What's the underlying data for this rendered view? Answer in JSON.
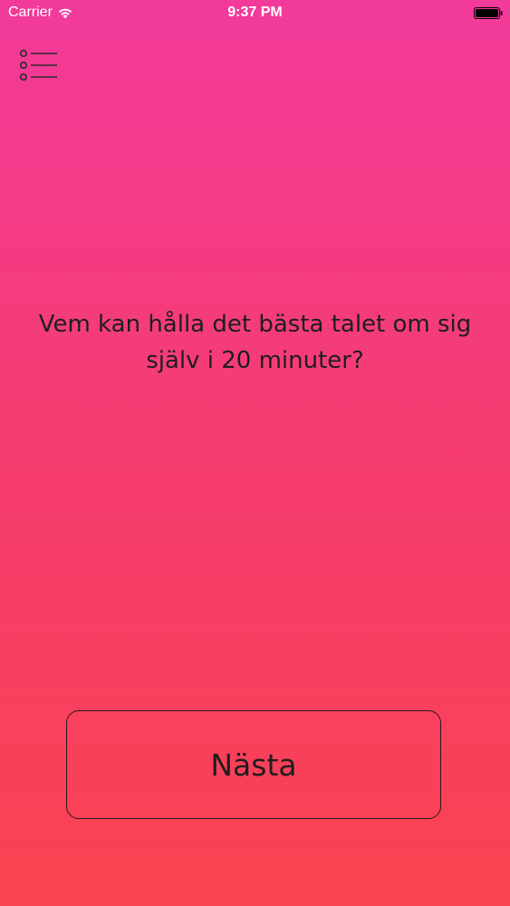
{
  "status_bar": {
    "carrier": "Carrier",
    "time": "9:37 PM",
    "wifi_icon": "wifi-icon",
    "battery_icon": "battery-icon"
  },
  "header": {
    "menu_icon": "list-menu-icon"
  },
  "main": {
    "question": "Vem kan hålla det bästa talet om sig själv i 20 minuter?",
    "next_label": "Nästa"
  },
  "colors": {
    "gradient_top": "#f23a9b",
    "gradient_bottom": "#fb4250",
    "status_text": "#ffffff",
    "text": "#1e1e1e"
  }
}
